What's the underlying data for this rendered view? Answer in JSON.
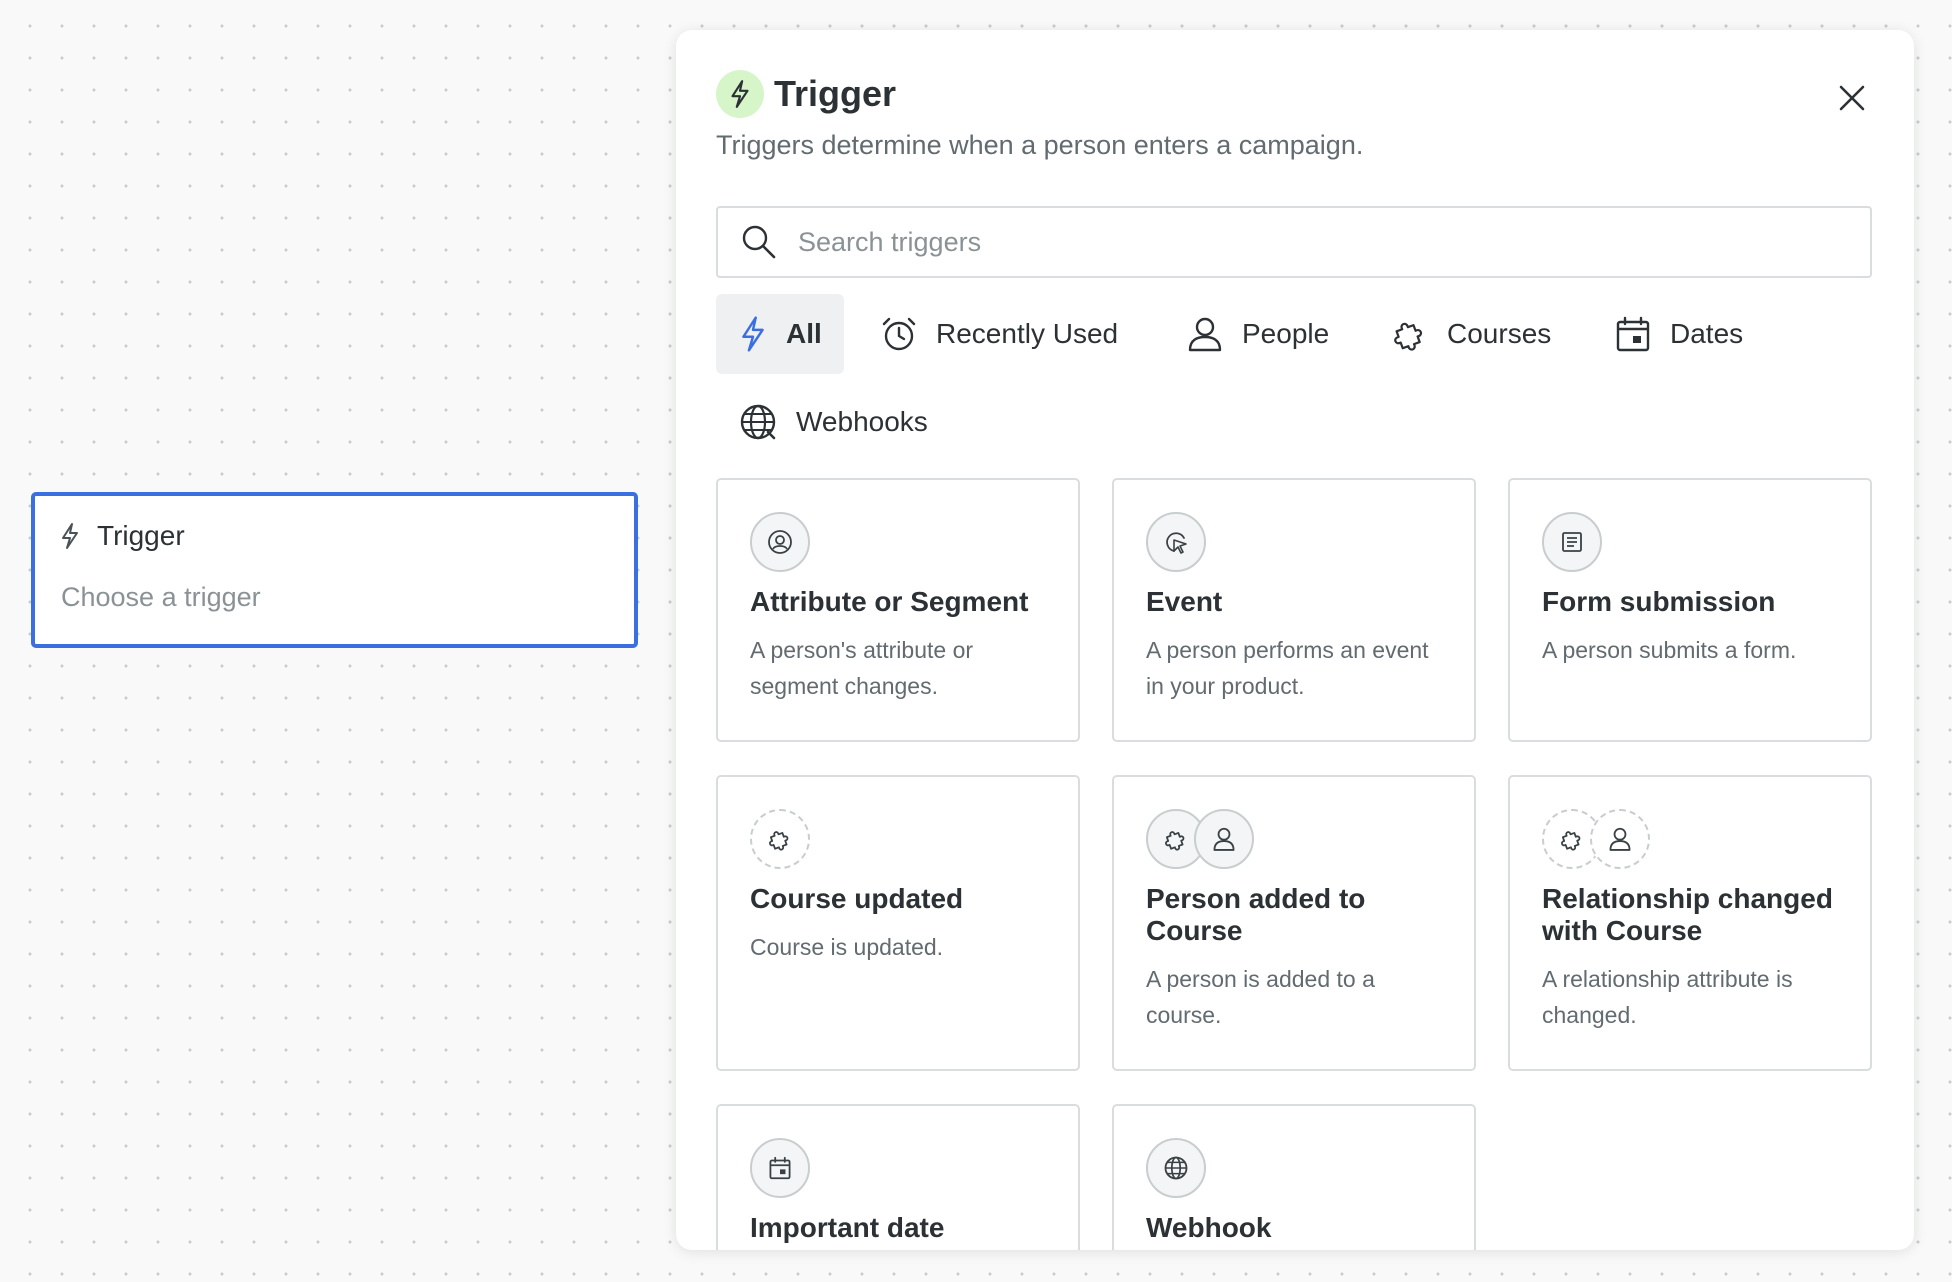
{
  "node": {
    "title": "Trigger",
    "subtitle": "Choose a trigger"
  },
  "panel": {
    "title": "Trigger",
    "subtitle": "Triggers determine when a person enters a campaign.",
    "search": {
      "placeholder": "Search triggers"
    },
    "tabs": [
      {
        "label": "All",
        "icon": "bolt-icon",
        "active": true
      },
      {
        "label": "Recently Used",
        "icon": "alarm-clock-icon"
      },
      {
        "label": "People",
        "icon": "person-icon"
      },
      {
        "label": "Courses",
        "icon": "puzzle-icon"
      },
      {
        "label": "Dates",
        "icon": "calendar-icon"
      },
      {
        "label": "Webhooks",
        "icon": "globe-icon"
      }
    ],
    "cards": [
      {
        "title": "Attribute or Segment",
        "description": "A person's attribute or segment changes.",
        "icons": [
          "person-circle-icon"
        ]
      },
      {
        "title": "Event",
        "description": "A person performs an event in your product.",
        "icons": [
          "cursor-click-icon"
        ]
      },
      {
        "title": "Form submission",
        "description": "A person submits a form.",
        "icons": [
          "form-icon"
        ]
      },
      {
        "title": "Course updated",
        "description": "Course is updated.",
        "icons": [
          "puzzle-icon"
        ]
      },
      {
        "title": "Person added to Course",
        "description": "A person is added to a course.",
        "icons": [
          "puzzle-icon",
          "person-icon"
        ]
      },
      {
        "title": "Relationship changed with Course",
        "description": "A relationship attribute is changed.",
        "icons": [
          "puzzle-icon",
          "person-icon"
        ]
      },
      {
        "title": "Important date",
        "description": "",
        "icons": [
          "calendar-icon"
        ]
      },
      {
        "title": "Webhook",
        "description": "",
        "icons": [
          "globe-icon"
        ]
      }
    ]
  },
  "colors": {
    "accent": "#3b6fe0",
    "bolt_badge": "#d6f5c8",
    "text": "#2b3134",
    "muted": "#626b70"
  }
}
